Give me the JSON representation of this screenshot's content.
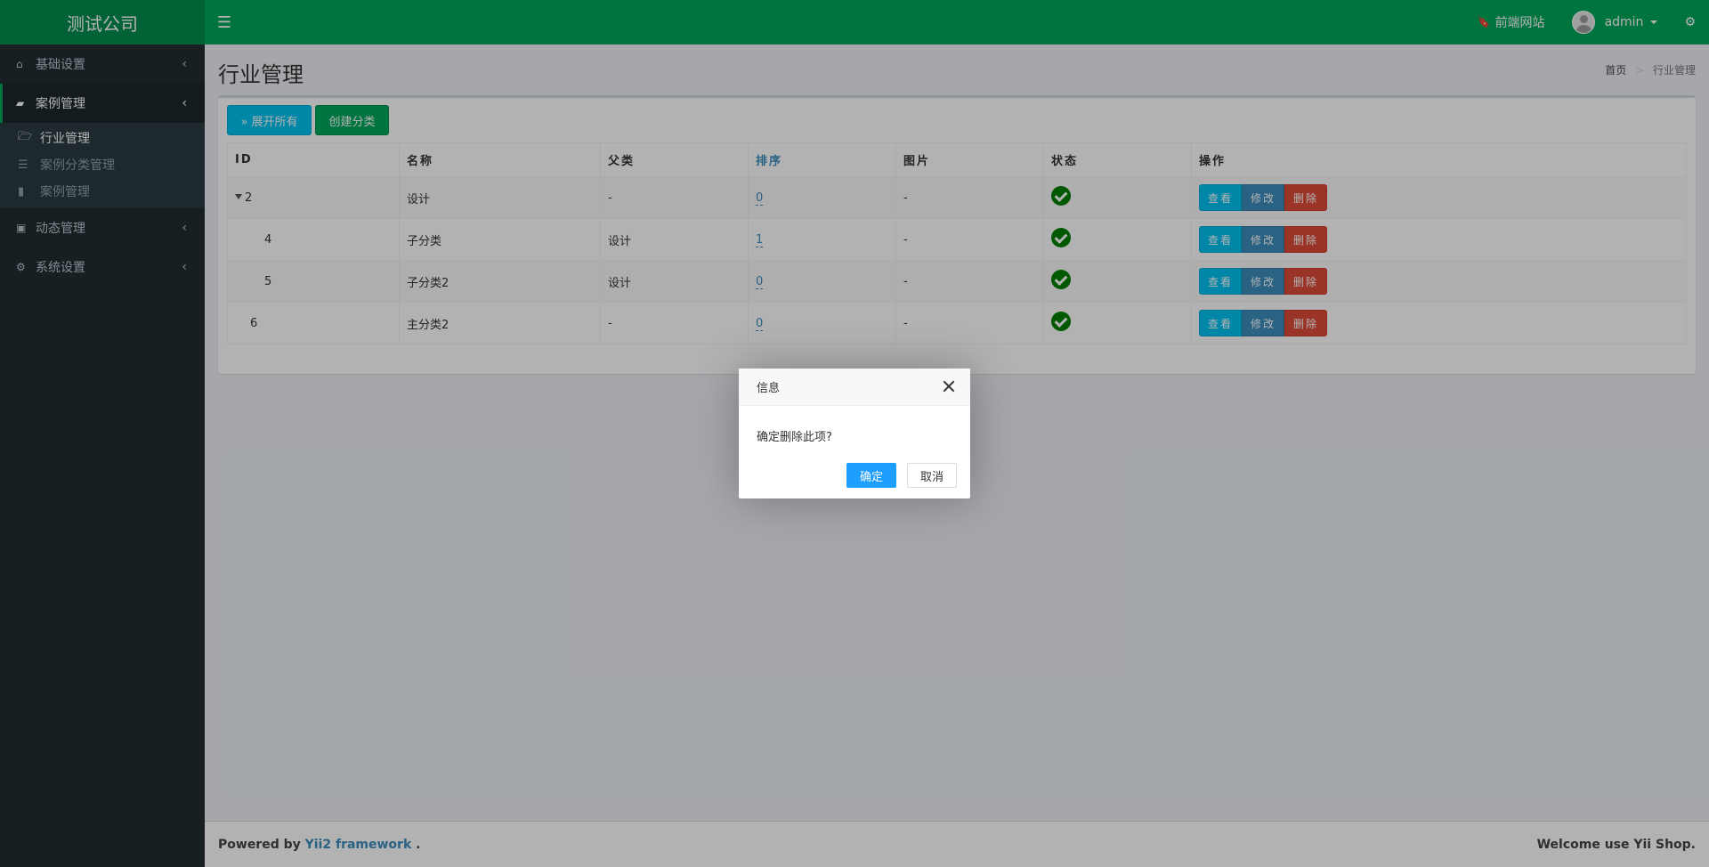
{
  "header": {
    "logo": "测试公司",
    "toggle_icon": "☰",
    "frontend_icon": "🔖",
    "frontend_label": "前端网站",
    "user_name": "admin",
    "settings_icon": "⚙"
  },
  "sidebar": {
    "items": [
      {
        "icon": "⌂",
        "label": "基础设置",
        "chev": "‹"
      },
      {
        "icon": "▰",
        "label": "案例管理",
        "chev": "‹"
      },
      {
        "icon": "▣",
        "label": "动态管理",
        "chev": "‹"
      },
      {
        "icon": "⚙",
        "label": "系统设置",
        "chev": "‹"
      }
    ],
    "sub_items": [
      {
        "icon": "🗁",
        "label": "行业管理"
      },
      {
        "icon": "☰",
        "label": "案例分类管理"
      },
      {
        "icon": "▮",
        "label": "案例管理"
      }
    ]
  },
  "page": {
    "title": "行业管理",
    "breadcrumb_home": "首页",
    "breadcrumb_sep": ">",
    "breadcrumb_current": "行业管理"
  },
  "toolbar": {
    "expand_label": "» 展开所有",
    "create_label": "创建分类"
  },
  "table": {
    "headers": [
      "ID",
      "名称",
      "父类",
      "排序",
      "图片",
      "状态",
      "操作"
    ],
    "rows": [
      {
        "id": "2",
        "name": "设计",
        "parent": "-",
        "sort": "0",
        "image": "-"
      },
      {
        "id": "4",
        "name": "子分类",
        "parent": "设计",
        "sort": "1",
        "image": "-"
      },
      {
        "id": "5",
        "name": "子分类2",
        "parent": "设计",
        "sort": "0",
        "image": "-"
      },
      {
        "id": "6",
        "name": "主分类2",
        "parent": "-",
        "sort": "0",
        "image": "-"
      }
    ],
    "view_label": "查看",
    "edit_label": "修改",
    "delete_label": "删除"
  },
  "footer": {
    "powered_prefix": "Powered by",
    "powered_link": "Yii2 framework",
    "powered_suffix": ".",
    "welcome": "Welcome use Yii Shop."
  },
  "dialog": {
    "title": "信息",
    "message": "确定删除此项?",
    "ok_label": "确定",
    "cancel_label": "取消"
  },
  "colors": {
    "brand": "#00a65a",
    "logo_bg": "#008d4c",
    "sidebar_bg": "#222d32",
    "view": "#00c0ef",
    "edit": "#3c8dbc",
    "delete": "#dd4b39",
    "dialog_ok": "#1e9fff"
  }
}
